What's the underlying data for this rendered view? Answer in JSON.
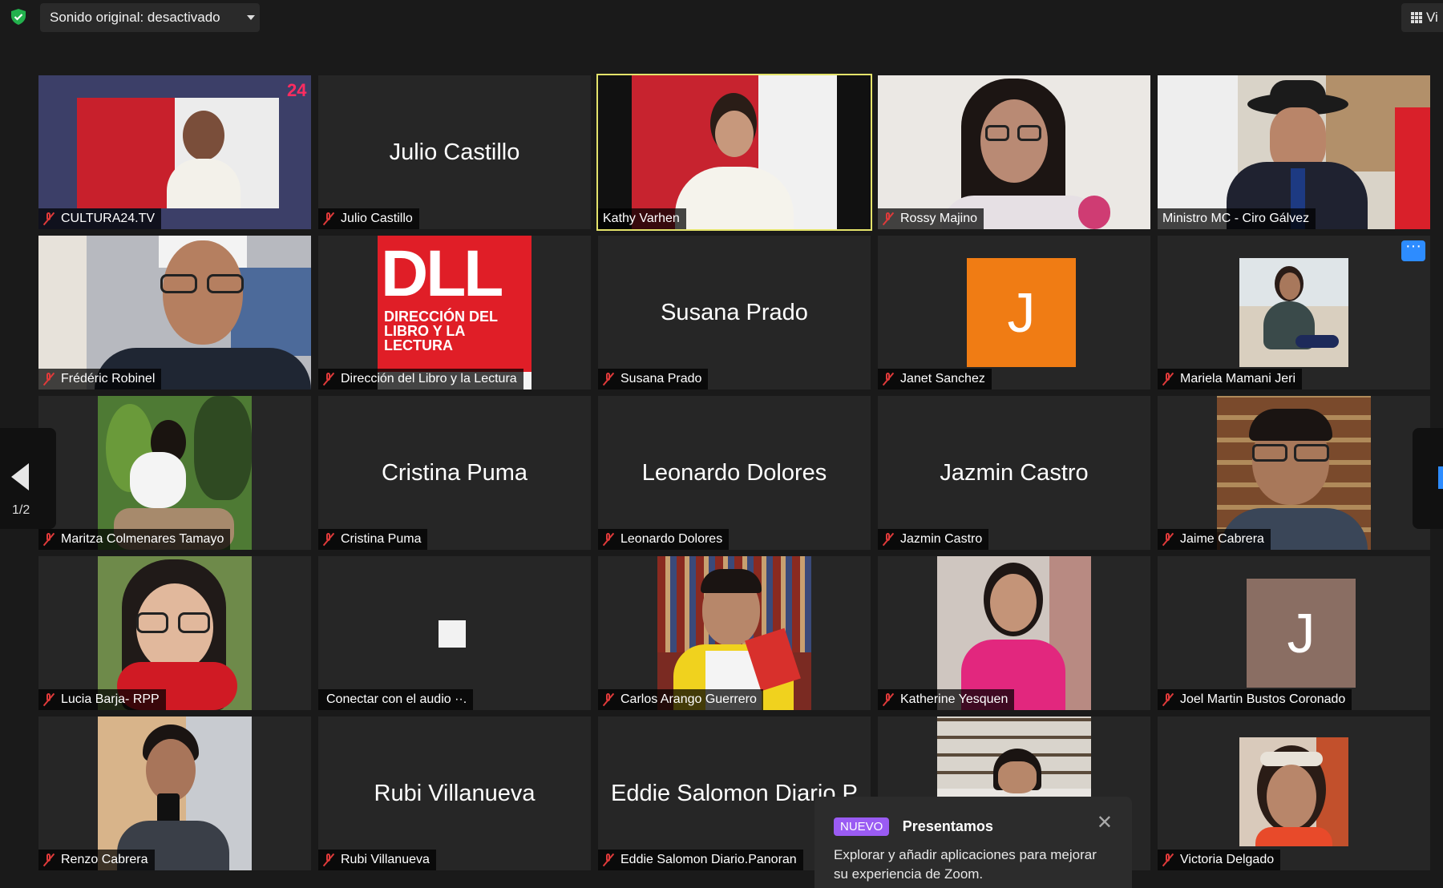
{
  "toolbar": {
    "audio_label": "Sonido original: desactivado",
    "view_label": "Vi"
  },
  "pagination": {
    "page": "1/2"
  },
  "participants": [
    {
      "name": "CULTURA24.TV"
    },
    {
      "name": "Julio Castillo",
      "display": "Julio Castillo"
    },
    {
      "name": "Kathy Varhen"
    },
    {
      "name": "Rossy Majino"
    },
    {
      "name": "Ministro MC - Ciro Gálvez"
    },
    {
      "name": "Frédéric Robinel"
    },
    {
      "name": "Dirección del Libro y  la Lectura",
      "logo_text": "DLL",
      "logo_sub": "DIRECCIÓN DEL LIBRO Y LA LECTURA"
    },
    {
      "name": "Susana Prado",
      "display": "Susana Prado"
    },
    {
      "name": "Janet Sanchez",
      "initial": "J"
    },
    {
      "name": "Mariela Mamani Jeri"
    },
    {
      "name": "Maritza Colmenares Tamayo"
    },
    {
      "name": "Cristina Puma",
      "display": "Cristina Puma"
    },
    {
      "name": "Leonardo Dolores",
      "display": "Leonardo Dolores"
    },
    {
      "name": "Jazmin Castro",
      "display": "Jazmin Castro"
    },
    {
      "name": "Jaime Cabrera"
    },
    {
      "name": "Lucia Barja- RPP"
    },
    {
      "name": "Conectar con el audio ··."
    },
    {
      "name": "Carlos Arango Guerrero"
    },
    {
      "name": "Katherine Yesquen"
    },
    {
      "name": "Joel Martin Bustos Coronado",
      "initial": "J"
    },
    {
      "name": "Renzo Cabrera"
    },
    {
      "name": "Rubi Villanueva",
      "display": "Rubi Villanueva"
    },
    {
      "name": "Eddie Salomon Diario.Panoran",
      "display": "Eddie Salomon Diario P"
    },
    {
      "name": ""
    },
    {
      "name": "Victoria Delgado"
    }
  ],
  "toast": {
    "badge": "NUEVO",
    "title": "Presentamos",
    "message": "Explorar y añadir aplicaciones para mejorar su experiencia de Zoom.",
    "close": "✕"
  },
  "colors": {
    "active_speaker": "#e4e36a",
    "janet_avatar": "#f07c14",
    "joel_avatar": "#8a6e63",
    "accent": "#2d8cff",
    "badge": "#9a5bf3"
  }
}
